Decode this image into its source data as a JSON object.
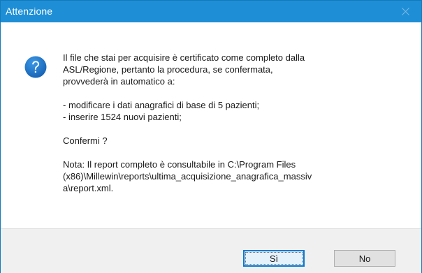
{
  "window": {
    "title": "Attenzione",
    "close_icon": "close-icon"
  },
  "message": {
    "icon": "question-icon",
    "paragraph1": [
      "Il file che stai per acquisire è certificato come completo dalla",
      "ASL/Regione, pertanto la procedura, se confermata,",
      "provvederà in automatico a:"
    ],
    "bullets": [
      "- modificare i dati anagrafici di base di 5 pazienti;",
      "- inserire 1524 nuovi pazienti;"
    ],
    "question": "Confermi ?",
    "note": [
      "Nota: Il report completo è consultabile in C:\\Program Files",
      "(x86)\\Millewin\\reports\\ultima_acquisizione_anagrafica_massiv",
      "a\\report.xml."
    ]
  },
  "buttons": {
    "yes_label": "Sì",
    "no_label": "No"
  },
  "colors": {
    "titlebar": "#1e8fd6",
    "footer": "#f0f0f0",
    "icon": "#1a6fc2",
    "default_button_border": "#0078d7"
  }
}
